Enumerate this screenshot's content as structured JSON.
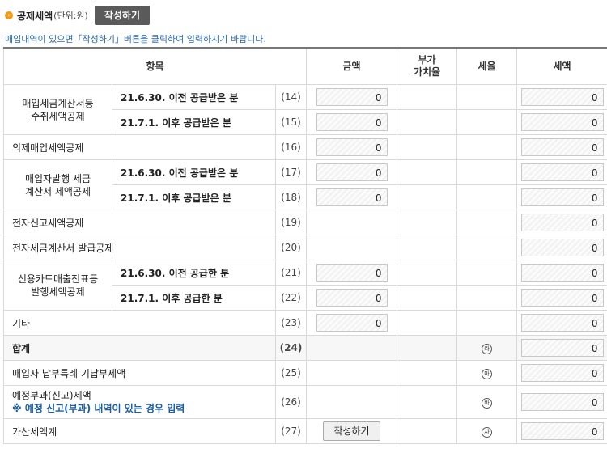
{
  "header": {
    "icon": "bullet-arrow-icon",
    "title": "공제세액",
    "unit": "(단위:원)",
    "write_button": "작성하기"
  },
  "note": "매입내역이 있으면「작성하기」버튼을 클릭하여 입력하시기 바랍니다.",
  "columns": {
    "item": "항목",
    "amount": "금액",
    "vat_rate_1": "부가",
    "vat_rate_2": "가치율",
    "tax_rate": "세율",
    "tax": "세액"
  },
  "groups": {
    "g1_l1": "매입세금계산서등",
    "g1_l2": "수취세액공제",
    "g2_l1": "매입자발행 세금",
    "g2_l2": "계산서 세액공제",
    "g3_l1": "신용카드매출전표등",
    "g3_l2": "발행세액공제"
  },
  "rows": {
    "r14": {
      "label": "21.6.30. 이전 공급받은 분",
      "num": "(14)",
      "amount": "0",
      "tax": "0"
    },
    "r15": {
      "label": "21.7.1. 이후 공급받은 분",
      "num": "(15)",
      "amount": "0",
      "tax": "0"
    },
    "r16": {
      "label": "의제매입세액공제",
      "num": "(16)",
      "amount": "0",
      "tax": "0"
    },
    "r17": {
      "label": "21.6.30. 이전 공급받은 분",
      "num": "(17)",
      "amount": "0",
      "tax": "0"
    },
    "r18": {
      "label": "21.7.1. 이후 공급받은 분",
      "num": "(18)",
      "amount": "0",
      "tax": "0"
    },
    "r19": {
      "label": "전자신고세액공제",
      "num": "(19)",
      "tax": "0"
    },
    "r20": {
      "label": "전자세금계산서 발급공제",
      "num": "(20)",
      "tax": "0"
    },
    "r21": {
      "label": "21.6.30. 이전 공급한 분",
      "num": "(21)",
      "amount": "0",
      "tax": "0"
    },
    "r22": {
      "label": "21.7.1. 이후 공급한 분",
      "num": "(22)",
      "amount": "0",
      "tax": "0"
    },
    "r23": {
      "label": "기타",
      "num": "(23)",
      "amount": "0",
      "tax": "0"
    },
    "r24": {
      "label": "합계",
      "num": "(24)",
      "rate": "라",
      "tax": "0"
    },
    "r25": {
      "label": "매입자 납부특례 기납부세액",
      "num": "(25)",
      "rate": "마",
      "tax": "0"
    },
    "r26": {
      "label": "예정부과(신고)세액",
      "note": "※ 예정 신고(부과) 내역이 있는 경우 입력",
      "num": "(26)",
      "rate": "바",
      "tax": "0"
    },
    "r27": {
      "label": "가산세액계",
      "num": "(27)",
      "button": "작성하기",
      "rate": "사",
      "tax": "0"
    }
  }
}
